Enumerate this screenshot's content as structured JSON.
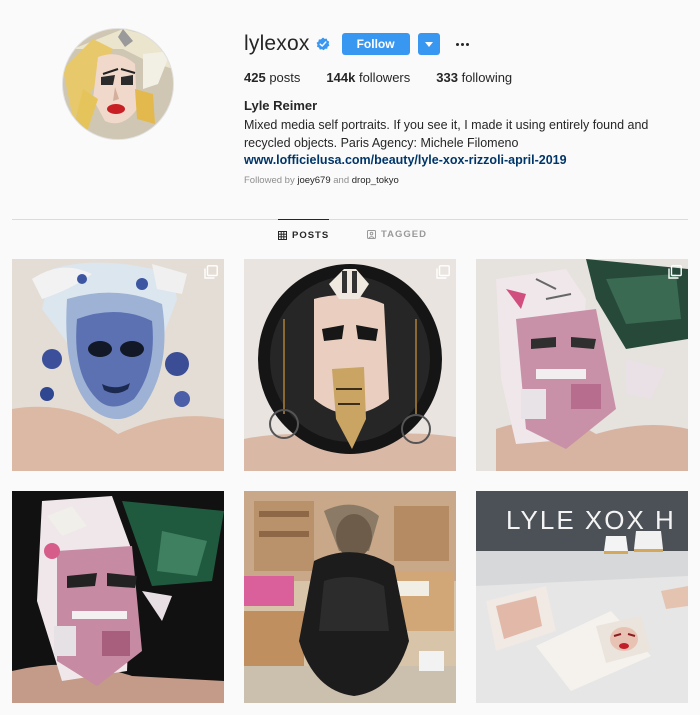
{
  "profile": {
    "username": "lylexox",
    "follow_label": "Follow",
    "stats": {
      "posts_count": "425",
      "posts_label": "posts",
      "followers_count": "144k",
      "followers_label": "followers",
      "following_count": "333",
      "following_label": "following"
    },
    "full_name": "Lyle Reimer",
    "bio": "Mixed media self portraits. If you see it, I made it using entirely found and recycled objects. Paris Agency: Michele Filomeno",
    "website": "www.lofficielusa.com/beauty/lyle-xox-rizzoli-april-2019",
    "followed_by_prefix": "Followed by",
    "followed_by_user1": "joey679",
    "followed_by_and": "and",
    "followed_by_user2": "drop_tokyo"
  },
  "tabs": {
    "posts": "POSTS",
    "tagged": "TAGGED"
  },
  "posts": [
    {
      "multi": true
    },
    {
      "multi": true
    },
    {
      "multi": true
    },
    {
      "multi": false
    },
    {
      "multi": false
    },
    {
      "multi": false
    }
  ],
  "post_overlay_text": {
    "window_sign": "LYLE XOX H"
  },
  "colors": {
    "accent": "#3897f0",
    "link": "#003569",
    "muted": "#8e8e8e",
    "background": "#fafafa"
  },
  "icons": {
    "verified": "verified-badge-icon",
    "dropdown": "chevron-down-icon",
    "more": "more-options-icon",
    "posts_tab": "grid-icon",
    "tagged_tab": "tag-icon",
    "multi": "multiple-photos-icon"
  }
}
